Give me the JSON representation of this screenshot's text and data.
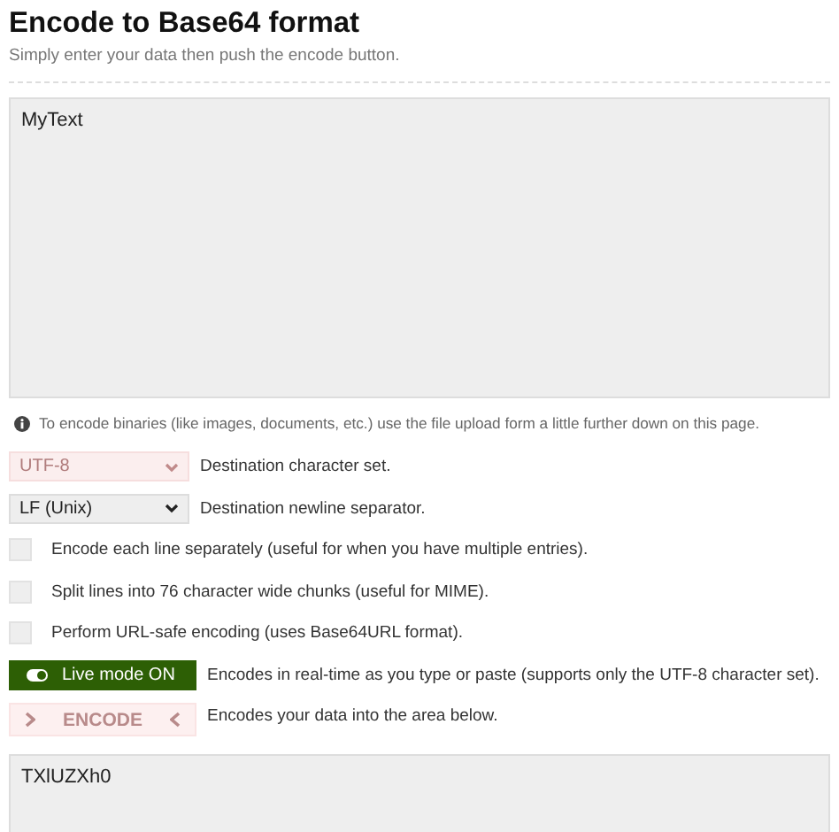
{
  "title": "Encode to Base64 format",
  "subtitle": "Simply enter your data then push the encode button.",
  "input": {
    "value": "MyText"
  },
  "info": "To encode binaries (like images, documents, etc.) use the file upload form a little further down on this page.",
  "selects": [
    {
      "value": "UTF-8",
      "disabled": true,
      "label": "Destination character set."
    },
    {
      "value": "LF (Unix)",
      "disabled": false,
      "label": "Destination newline separator."
    }
  ],
  "checkboxes": [
    {
      "label": "Encode each line separately (useful for when you have multiple entries).",
      "checked": false
    },
    {
      "label": "Split lines into 76 character wide chunks (useful for MIME).",
      "checked": false
    },
    {
      "label": "Perform URL-safe encoding (uses Base64URL format).",
      "checked": false
    }
  ],
  "live_mode": {
    "label": "Live mode ON",
    "on": true,
    "description": "Encodes in real-time as you type or paste (supports only the UTF-8 character set)."
  },
  "encode_button": {
    "label": "ENCODE",
    "disabled": true,
    "description": "Encodes your data into the area below."
  },
  "output": {
    "value": "TXlUZXh0"
  }
}
